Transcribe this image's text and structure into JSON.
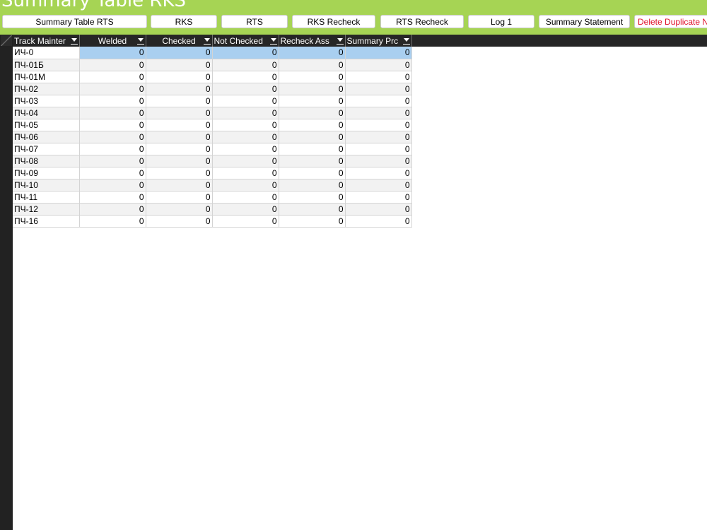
{
  "title": "Summary Table RKS",
  "toolbar": [
    {
      "label": "Summary Table RTS"
    },
    {
      "label": "RKS"
    },
    {
      "label": "RTS"
    },
    {
      "label": "RKS Recheck"
    },
    {
      "label": "RTS Recheck"
    },
    {
      "label": "Log 1"
    },
    {
      "label": "Summary Statement"
    },
    {
      "label": "Delete Duplicate N"
    }
  ],
  "columns": [
    {
      "label": "Track Mainter"
    },
    {
      "label": "Welded"
    },
    {
      "label": "Checked"
    },
    {
      "label": "Not Checked"
    },
    {
      "label": "Recheck Ass"
    },
    {
      "label": "Summary Prc"
    }
  ],
  "rows": [
    {
      "name": "ИЧ-0",
      "values": [
        "0",
        "0",
        "0",
        "0",
        "0"
      ]
    },
    {
      "name": "ПЧ-01Б",
      "values": [
        "0",
        "0",
        "0",
        "0",
        "0"
      ]
    },
    {
      "name": "ПЧ-01М",
      "values": [
        "0",
        "0",
        "0",
        "0",
        "0"
      ]
    },
    {
      "name": "ПЧ-02",
      "values": [
        "0",
        "0",
        "0",
        "0",
        "0"
      ]
    },
    {
      "name": "ПЧ-03",
      "values": [
        "0",
        "0",
        "0",
        "0",
        "0"
      ]
    },
    {
      "name": "ПЧ-04",
      "values": [
        "0",
        "0",
        "0",
        "0",
        "0"
      ]
    },
    {
      "name": "ПЧ-05",
      "values": [
        "0",
        "0",
        "0",
        "0",
        "0"
      ]
    },
    {
      "name": "ПЧ-06",
      "values": [
        "0",
        "0",
        "0",
        "0",
        "0"
      ]
    },
    {
      "name": "ПЧ-07",
      "values": [
        "0",
        "0",
        "0",
        "0",
        "0"
      ]
    },
    {
      "name": "ПЧ-08",
      "values": [
        "0",
        "0",
        "0",
        "0",
        "0"
      ]
    },
    {
      "name": "ПЧ-09",
      "values": [
        "0",
        "0",
        "0",
        "0",
        "0"
      ]
    },
    {
      "name": "ПЧ-10",
      "values": [
        "0",
        "0",
        "0",
        "0",
        "0"
      ]
    },
    {
      "name": "ПЧ-11",
      "values": [
        "0",
        "0",
        "0",
        "0",
        "0"
      ]
    },
    {
      "name": "ПЧ-12",
      "values": [
        "0",
        "0",
        "0",
        "0",
        "0"
      ]
    },
    {
      "name": "ПЧ-16",
      "values": [
        "0",
        "0",
        "0",
        "0",
        "0"
      ]
    }
  ],
  "colors": {
    "header_green": "#a6d454",
    "grid_header": "#262626",
    "selection": "#a9cff0",
    "danger_text": "#e0102a"
  }
}
